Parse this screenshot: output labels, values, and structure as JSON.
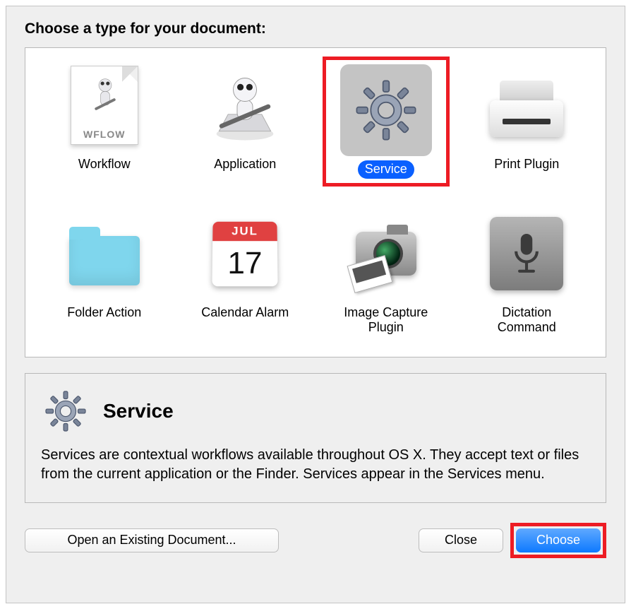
{
  "prompt": "Choose a type for your document:",
  "types": [
    {
      "id": "workflow",
      "label": "Workflow",
      "doc_tag": "WFLOW"
    },
    {
      "id": "application",
      "label": "Application"
    },
    {
      "id": "service",
      "label": "Service",
      "selected": true
    },
    {
      "id": "print-plugin",
      "label": "Print Plugin"
    },
    {
      "id": "folder-action",
      "label": "Folder Action"
    },
    {
      "id": "calendar-alarm",
      "label": "Calendar Alarm",
      "cal_month": "JUL",
      "cal_day": "17"
    },
    {
      "id": "image-capture-plugin",
      "label": "Image Capture Plugin"
    },
    {
      "id": "dictation-command",
      "label": "Dictation Command"
    }
  ],
  "info": {
    "title": "Service",
    "description": "Services are contextual workflows available throughout OS X. They accept text or files from the current application or the Finder. Services appear in the Services menu."
  },
  "buttons": {
    "open_existing": "Open an Existing Document...",
    "close": "Close",
    "choose": "Choose"
  },
  "highlights": {
    "service_cell": true,
    "choose_button": true
  }
}
